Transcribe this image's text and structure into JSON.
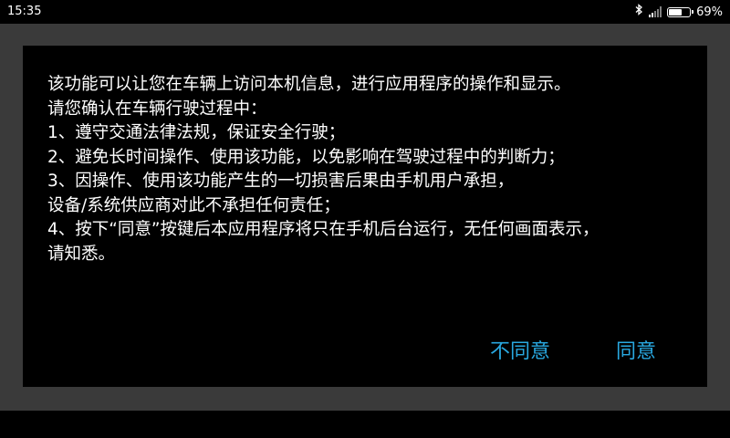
{
  "status_bar": {
    "time": "15:35",
    "battery_percent": "69%",
    "battery_level": 0.69,
    "icons": [
      "bluetooth-icon",
      "signal-icon",
      "battery-icon"
    ]
  },
  "dialog": {
    "lines": [
      "该功能可以让您在车辆上访问本机信息，进行应用程序的操作和显示。",
      "请您确认在车辆行驶过程中：",
      " 1、遵守交通法律法规，保证安全行驶；",
      " 2、避免长时间操作、使用该功能，以免影响在驾驶过程中的判断力；",
      " 3、因操作、使用该功能产生的一切损害后果由手机用户承担，",
      "设备/系统供应商对此不承担任何责任；",
      " 4、按下“同意”按键后本应用程序将只在手机后台运行，无任何画面表示，",
      "请知悉。"
    ],
    "buttons": {
      "disagree": "不同意",
      "agree": "同意"
    }
  },
  "colors": {
    "button_text": "#29a8e0",
    "backdrop": "#3a3a3a",
    "dialog_bg": "#000000",
    "text": "#ffffff"
  }
}
